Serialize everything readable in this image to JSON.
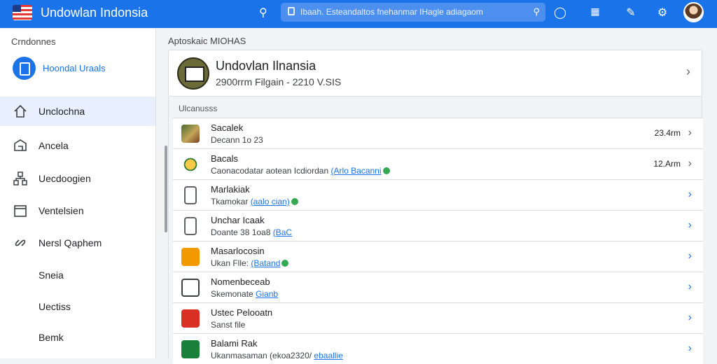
{
  "header": {
    "app_title": "Undowlan Indonsia",
    "search_placeholder": "Ibaah. Esteandaltos fnehanmar IHagle adiagaom",
    "icons": [
      "search-icon",
      "shield-icon",
      "apps-grid-icon",
      "add-account-icon",
      "settings-icon",
      "avatar"
    ],
    "accent_color": "#1a73e8"
  },
  "sidebar": {
    "heading": "Crndonnes",
    "account_label": "Hoondal Uraals",
    "items": [
      {
        "label": "Unclochna",
        "icon": "home-icon",
        "active": true
      },
      {
        "label": "Ancela",
        "icon": "mail-icon"
      },
      {
        "label": "Uecdoogien",
        "icon": "network-icon"
      },
      {
        "label": "Ventelsien",
        "icon": "calendar-icon"
      },
      {
        "label": "Nersl Qaphem",
        "icon": "link-icon"
      },
      {
        "label": "Sneia",
        "icon": ""
      },
      {
        "label": "Uectiss",
        "icon": ""
      },
      {
        "label": "Bemk",
        "icon": ""
      }
    ]
  },
  "main": {
    "section_label": "Aptoskaic MIOHAS",
    "hero": {
      "title": "Undovlan Ilnansia",
      "subtitle": "2900rrm Filgain - 2210 V.SIS"
    },
    "list_label": "Ulcanusss",
    "rows": [
      {
        "title": "Sacalek",
        "subtitle": "Decann 1o 23",
        "link": "",
        "verified": false,
        "time": "23.4rm",
        "icon": "photo-icon",
        "icon_class": "i-photo"
      },
      {
        "title": "Bacals",
        "subtitle": "Caonacodatar aotean Icdiordan ",
        "link": "(Arlo Bacanni",
        "verified": true,
        "time": "12.Arm",
        "icon": "stamp-icon",
        "icon_class": "i-stamp"
      },
      {
        "title": "Marlakiak",
        "subtitle": "Tkamokar ",
        "link": "(aalo cian)",
        "verified": true,
        "time": "",
        "icon": "document-icon",
        "icon_class": "i-doc"
      },
      {
        "title": "Unchar Icaak",
        "subtitle": "Doante 38 1oa8 ",
        "link": "(BaC",
        "verified": false,
        "time": "",
        "icon": "document-icon",
        "icon_class": "i-doc"
      },
      {
        "title": "Masarlocosin",
        "subtitle": "Ukan Flle: ",
        "link": "(Batand",
        "verified": true,
        "time": "",
        "icon": "folder-icon",
        "icon_class": "i-orange"
      },
      {
        "title": "Nomenbeceab",
        "subtitle": "Skemonate ",
        "link": "Gianb",
        "verified": false,
        "time": "",
        "icon": "list-icon",
        "icon_class": "i-list"
      },
      {
        "title": "Ustec Pelooatn",
        "subtitle": "Sanst file",
        "link": "",
        "verified": false,
        "time": "",
        "icon": "badge-icon",
        "icon_class": "i-red"
      },
      {
        "title": "Balami Rak",
        "subtitle": "Ukanmasaman (ekoa2320/ ",
        "link": "ebaallie",
        "verified": false,
        "time": "",
        "icon": "sheet-icon",
        "icon_class": "i-green"
      }
    ]
  }
}
